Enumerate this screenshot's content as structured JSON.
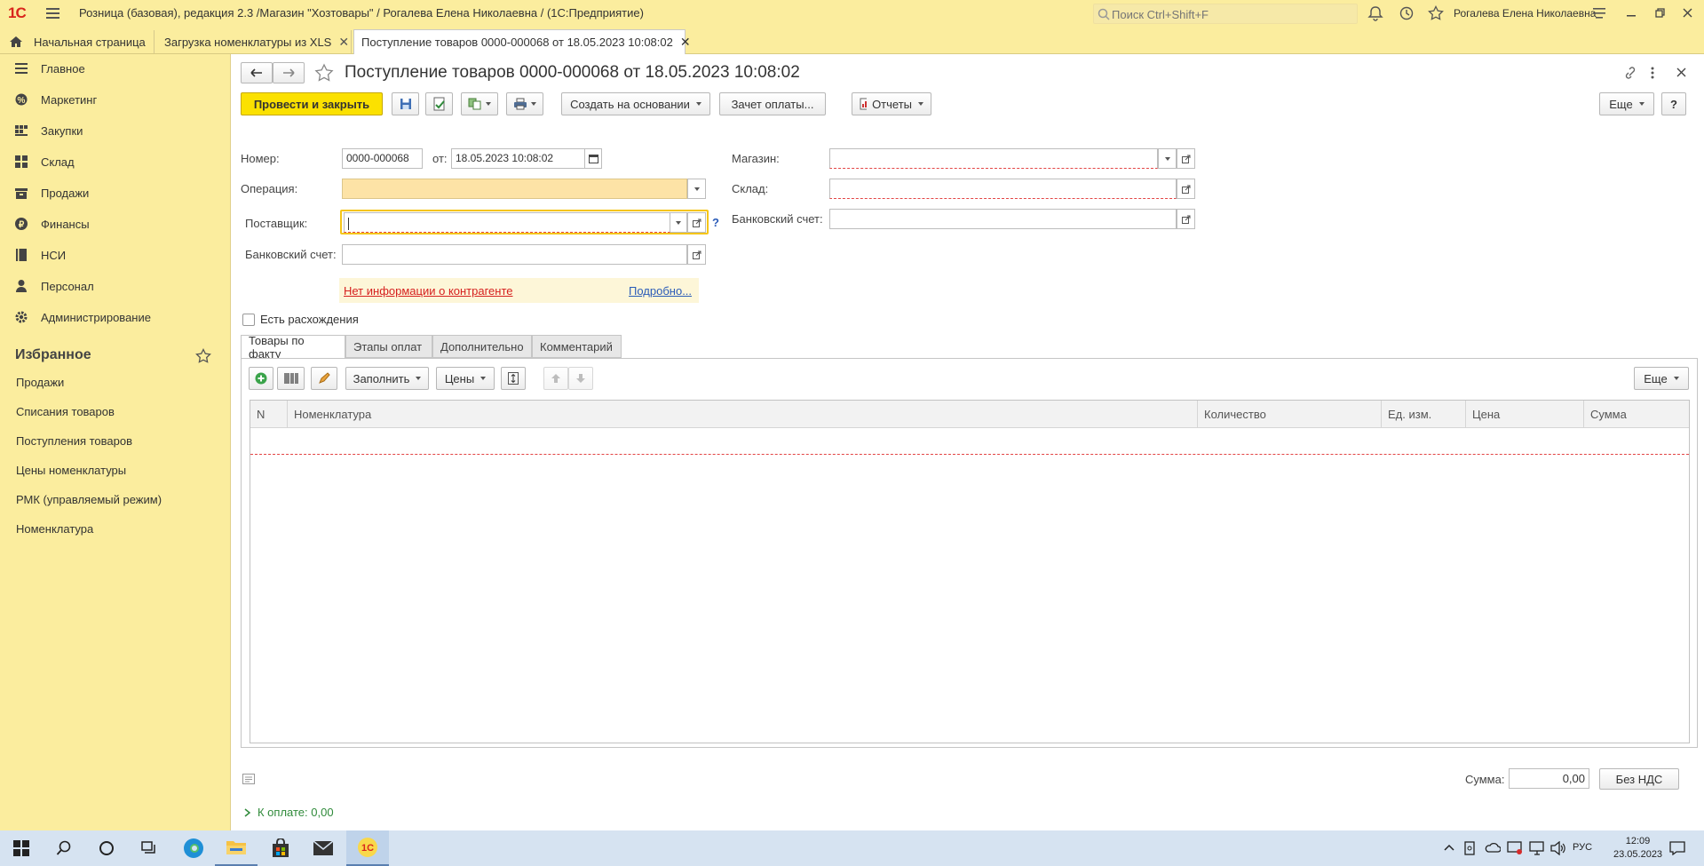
{
  "titlebar": {
    "logo": "1С",
    "title": "Розница (базовая), редакция 2.3 /Магазин \"Хозтовары\" / Рогалева Елена Николаевна /  (1С:Предприятие)",
    "search_placeholder": "Поиск Ctrl+Shift+F",
    "user": "Рогалева Елена Николаевна"
  },
  "tabs": [
    {
      "label": "Начальная страница"
    },
    {
      "label": "Загрузка номенклатуры из XLS"
    },
    {
      "label": "Поступление товаров 0000-000068 от 18.05.2023 10:08:02"
    }
  ],
  "sidebar": {
    "items": [
      {
        "label": "Главное",
        "icon": "list-icon"
      },
      {
        "label": "Маркетинг",
        "icon": "marketing-icon"
      },
      {
        "label": "Закупки",
        "icon": "purchases-icon"
      },
      {
        "label": "Склад",
        "icon": "warehouse-icon"
      },
      {
        "label": "Продажи",
        "icon": "sales-icon"
      },
      {
        "label": "Финансы",
        "icon": "finance-icon"
      },
      {
        "label": "НСИ",
        "icon": "book-icon"
      },
      {
        "label": "Персонал",
        "icon": "person-icon"
      },
      {
        "label": "Администрирование",
        "icon": "gear-icon"
      }
    ],
    "favorites_title": "Избранное",
    "favorites": [
      {
        "label": "Продажи"
      },
      {
        "label": "Списания товаров"
      },
      {
        "label": "Поступления товаров"
      },
      {
        "label": "Цены номенклатуры"
      },
      {
        "label": "РМК (управляемый режим)"
      },
      {
        "label": "Номенклатура"
      }
    ]
  },
  "document": {
    "title": "Поступление товаров 0000-000068 от 18.05.2023 10:08:02",
    "toolbar": {
      "post_close": "Провести и закрыть",
      "create_based": "Создать на основании",
      "payment_offset": "Зачет оплаты...",
      "reports": "Отчеты",
      "more": "Еще",
      "help": "?"
    },
    "fields": {
      "number_label": "Номер:",
      "number_value": "0000-000068",
      "date_label": "от:",
      "date_value": "18.05.2023 10:08:02",
      "operation_label": "Операция:",
      "operation_value": "",
      "supplier_label": "Поставщик:",
      "supplier_value": "",
      "bank_label": "Банковский счет:",
      "bank_value": "",
      "store_label": "Магазин:",
      "store_value": "",
      "warehouse_label": "Склад:",
      "warehouse_value": "",
      "store_bank_label": "Банковский счет:",
      "store_bank_value": "",
      "question_mark": "?"
    },
    "info": {
      "no_info": "Нет информации о контрагенте",
      "details": "Подробно..."
    },
    "discrepancy_label": "Есть расхождения",
    "form_tabs": [
      {
        "label": "Товары по факту"
      },
      {
        "label": "Этапы оплат"
      },
      {
        "label": "Дополнительно"
      },
      {
        "label": "Комментарий"
      }
    ],
    "table_toolbar": {
      "fill": "Заполнить",
      "prices": "Цены",
      "more": "Еще"
    },
    "table": {
      "columns": [
        "N",
        "Номенклатура",
        "Количество",
        "Ед. изм.",
        "Цена",
        "Сумма"
      ],
      "rows": []
    },
    "footer": {
      "sum_label": "Сумма:",
      "sum_value": "0,00",
      "vat": "Без НДС",
      "to_pay": "К оплате: 0,00"
    }
  },
  "taskbar": {
    "lang": "РУС",
    "time": "12:09",
    "date": "23.05.2023"
  },
  "colors": {
    "panel": "#fbed9e",
    "primary_button": "#fbe100",
    "required_border": "#e34545",
    "operation_fill": "#fde3a6",
    "link_red": "#d6201f",
    "link_blue": "#2a5bb8",
    "green": "#2f8a3a"
  }
}
